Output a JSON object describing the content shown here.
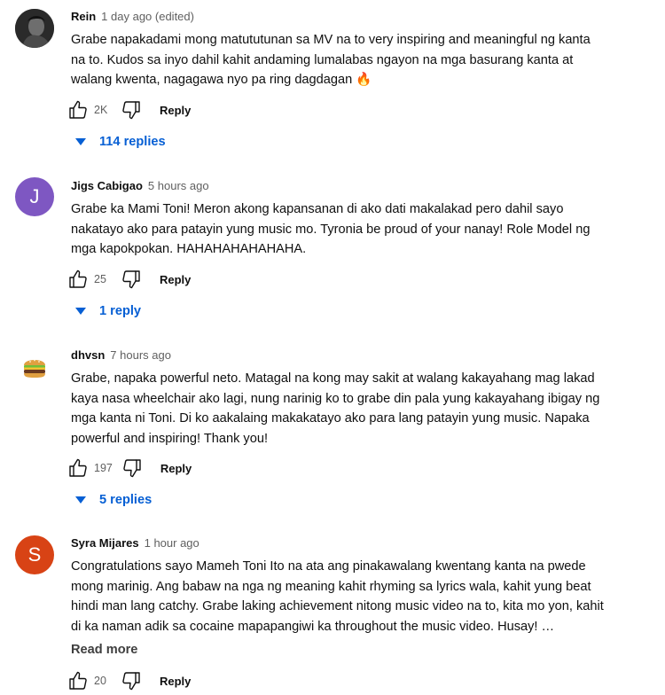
{
  "comments": [
    {
      "author": "Rein",
      "time": "1 day ago (edited)",
      "lines": [
        "Grabe napakadami mong matututunan sa MV na to very inspiring and meaningful ng kanta",
        "na to. Kudos sa inyo dahil kahit andaming lumalabas ngayon na mga basurang kanta at",
        "walang kwenta, nagagawa nyo pa ring dagdagan 🔥"
      ],
      "likes": "2K",
      "reply_label": "Reply",
      "replies_label": "114 replies",
      "avatar_icon": "profile-photo-icon"
    },
    {
      "author": "Jigs Cabigao",
      "time": "5 hours ago",
      "avatar_letter": "J",
      "avatar_color": "#7e57c2",
      "lines": [
        "Grabe ka Mami Toni! Meron akong kapansanan di ako dati makalakad pero dahil sayo",
        "nakatayo ako para patayin yung music mo. Tyronia be proud of your nanay! Role Model ng",
        "mga kapokpokan. HAHAHAHAHAHAHA."
      ],
      "likes": "25",
      "reply_label": "Reply",
      "replies_label": "1 reply"
    },
    {
      "author": "dhvsn",
      "time": "7 hours ago",
      "avatar_icon": "burger-icon",
      "lines": [
        "Grabe, napaka powerful neto. Matagal na kong may sakit at walang kakayahang mag lakad",
        "kaya nasa wheelchair ako lagi, nung narinig ko to grabe din pala yung kakayahang ibigay ng",
        "mga kanta ni Toni. Di ko aakalaing makakatayo ako para lang patayin yung music. Napaka",
        "powerful and inspiring! Thank you!"
      ],
      "likes": "197",
      "reply_label": "Reply",
      "replies_label": "5 replies"
    },
    {
      "author": "Syra Mijares",
      "time": "1 hour ago",
      "avatar_letter": "S",
      "avatar_color": "#d84315",
      "lines": [
        "Congratulations sayo Mameh Toni Ito na ata ang pinakawalang kwentang kanta na pwede",
        "mong marinig. Ang babaw na nga ng meaning kahit rhyming sa lyrics wala, kahit yung beat",
        "hindi man lang catchy. Grabe laking achievement nitong music video na to, kita mo yon, kahit",
        "di ka naman adik sa cocaine mapapangiwi ka throughout the music video. Husay! …"
      ],
      "read_more": "Read more",
      "likes": "20",
      "reply_label": "Reply"
    }
  ],
  "colors": {
    "link_blue": "#065fd4",
    "meta_gray": "#606060"
  }
}
